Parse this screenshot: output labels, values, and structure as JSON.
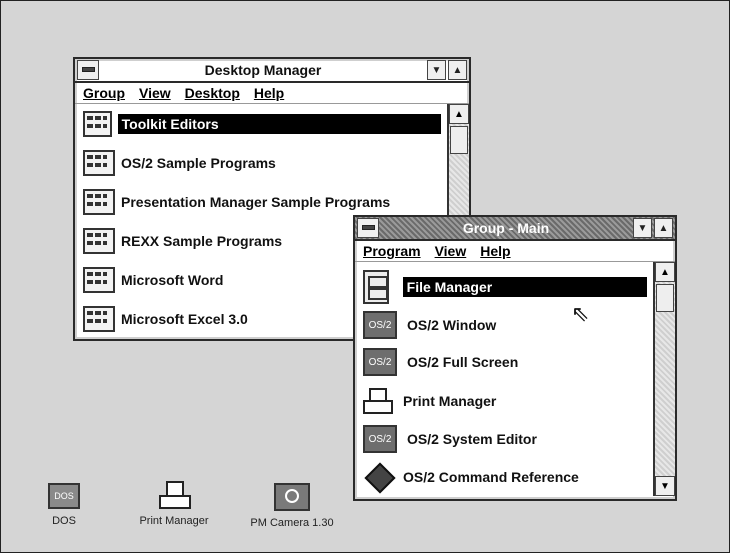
{
  "desktop_manager": {
    "title": "Desktop Manager",
    "menu": [
      "Group",
      "View",
      "Desktop",
      "Help"
    ],
    "items": [
      {
        "label": "Toolkit Editors",
        "selected": true
      },
      {
        "label": "OS/2 Sample Programs"
      },
      {
        "label": "Presentation Manager Sample Programs"
      },
      {
        "label": "REXX Sample Programs"
      },
      {
        "label": "Microsoft Word"
      },
      {
        "label": "Microsoft Excel 3.0"
      }
    ]
  },
  "group_main": {
    "title": "Group - Main",
    "menu": [
      "Program",
      "View",
      "Help"
    ],
    "items": [
      {
        "label": "File Manager",
        "selected": true,
        "icon": "file-cabinet-icon"
      },
      {
        "label": "OS/2 Window",
        "icon": "os2-window-icon",
        "icon_text": "OS/2"
      },
      {
        "label": "OS/2 Full Screen",
        "icon": "os2-fullscreen-icon",
        "icon_text": "OS/2"
      },
      {
        "label": "Print Manager",
        "icon": "printer-icon"
      },
      {
        "label": "OS/2 System Editor",
        "icon": "editor-icon",
        "icon_text": "OS/2"
      },
      {
        "label": "OS/2 Command Reference",
        "icon": "book-icon"
      }
    ]
  },
  "desktop_icons": [
    {
      "label": "DOS",
      "icon": "dos-icon",
      "icon_text": "DOS"
    },
    {
      "label": "Print Manager",
      "icon": "printer-icon"
    },
    {
      "label": "PM Camera 1.30",
      "icon": "camera-icon"
    }
  ]
}
